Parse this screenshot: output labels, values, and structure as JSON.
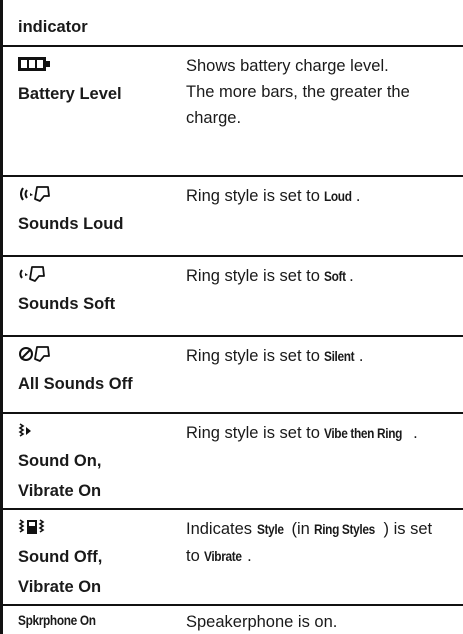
{
  "table": {
    "header": "indicator",
    "rows": [
      {
        "icon": "battery-full-icon",
        "name_lines": [
          "Battery Level"
        ],
        "desc": [
          "Shows battery charge level.",
          "The more bars, the greater the",
          "charge."
        ]
      },
      {
        "icon": "ring-loud-icon",
        "name_lines": [
          "Sounds Loud"
        ],
        "desc_before": "Ring style is set to ",
        "desc_key": "Loud",
        "desc_after": "."
      },
      {
        "icon": "ring-soft-icon",
        "name_lines": [
          "Sounds Soft"
        ],
        "desc_before": "Ring style is set to ",
        "desc_key": "Soft",
        "desc_after": "."
      },
      {
        "icon": "ring-silent-icon",
        "name_lines": [
          "All Sounds Off"
        ],
        "desc_before": "Ring style is set to ",
        "desc_key": "Silent",
        "desc_after": "."
      },
      {
        "icon": "vibe-then-ring-icon",
        "name_lines": [
          "Sound On,",
          "Vibrate On"
        ],
        "desc_before": "Ring style is set to ",
        "desc_key": "Vibe then Ring",
        "desc_after": "."
      },
      {
        "icon": "vibrate-icon",
        "name_lines": [
          "Sound Off,",
          "Vibrate On"
        ],
        "desc_line1_a": "Indicates ",
        "desc_line1_k1": "Style",
        "desc_line1_b": " (in ",
        "desc_line1_k2": "Ring Styles",
        "desc_line1_c": ") is set",
        "desc_line2_a": "to ",
        "desc_line2_k": "Vibrate",
        "desc_line2_b": "."
      },
      {
        "name": "Spkrphone On",
        "desc": "Speakerphone is on."
      }
    ]
  }
}
